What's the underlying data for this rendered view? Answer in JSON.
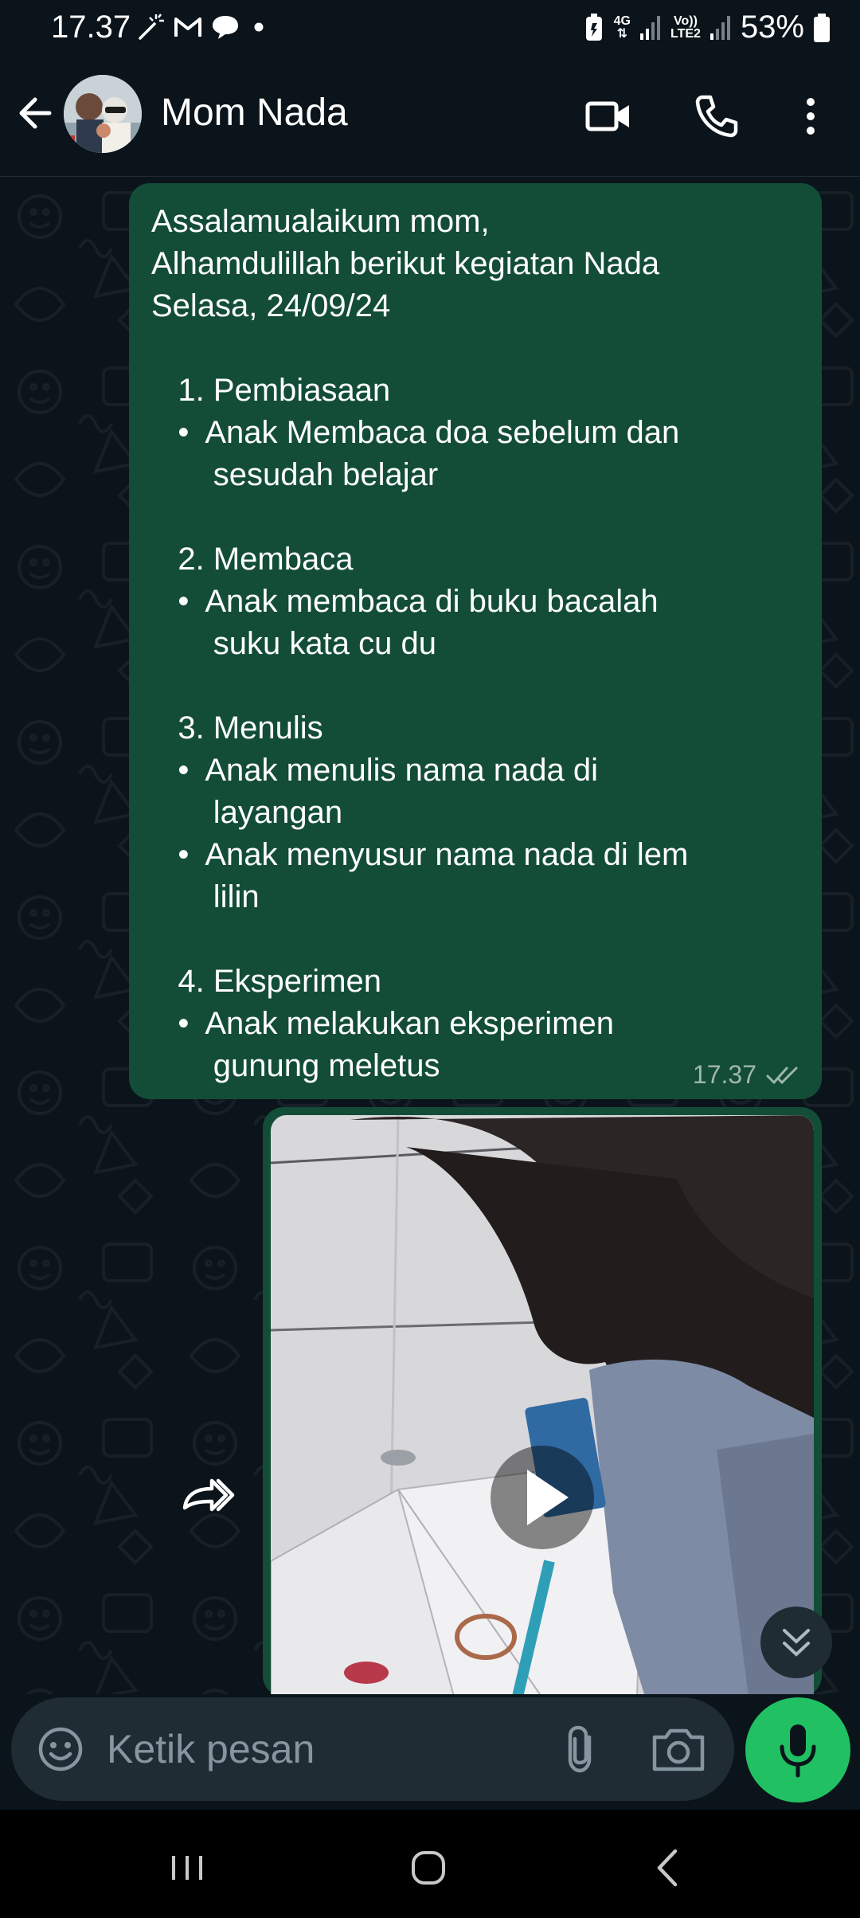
{
  "status_bar": {
    "time": "17.37",
    "battery": "53%",
    "network_1": "4G",
    "network_2_top": "Vo))",
    "network_2_bottom": "LTE2",
    "left_icons": [
      "magic-wand-icon",
      "gmail-icon",
      "chat-bubble-icon",
      "dot-icon"
    ],
    "right_icons": [
      "battery-saver-icon",
      "signal-icon",
      "signal-icon",
      "battery-icon"
    ]
  },
  "header": {
    "contact_name": "Mom Nada",
    "icons": [
      "back-arrow-icon",
      "video-call-icon",
      "phone-icon",
      "more-vert-icon"
    ]
  },
  "messages": [
    {
      "type": "text",
      "direction": "outgoing",
      "lines": [
        "Assalamualaikum mom,",
        "Alhamdulillah berikut kegiatan Nada",
        "Selasa, 24/09/24",
        "",
        "   1. Pembiasaan",
        "   •  Anak Membaca doa sebelum dan",
        "       sesudah belajar",
        "",
        "   2. Membaca",
        "   •  Anak membaca di buku bacalah",
        "       suku kata cu du",
        "",
        "   3. Menulis",
        "   •  Anak menulis nama nada di",
        "       layangan",
        "   •  Anak menyusur nama nada di lem",
        "       lilin",
        "",
        "   4. Eksperimen",
        "   •  Anak melakukan eksperimen",
        "       gunung meletus"
      ],
      "time": "17.37",
      "status": "read-double-check"
    },
    {
      "type": "video",
      "direction": "outgoing",
      "thumbnail": "child-writing-on-kite-photo",
      "icons": [
        "play-icon",
        "forward-icon"
      ]
    }
  ],
  "input": {
    "placeholder": "Ketik pesan",
    "icons": [
      "emoji-icon",
      "attach-icon",
      "camera-icon",
      "mic-icon"
    ]
  },
  "nav": {
    "icons": [
      "recents-icon",
      "home-icon",
      "back-icon"
    ]
  },
  "colors": {
    "background": "#0b141a",
    "bubble_outgoing": "#134d37",
    "accent_green": "#21c063",
    "input_bg": "#1f2c34",
    "read_check": "#9fb6ad"
  }
}
